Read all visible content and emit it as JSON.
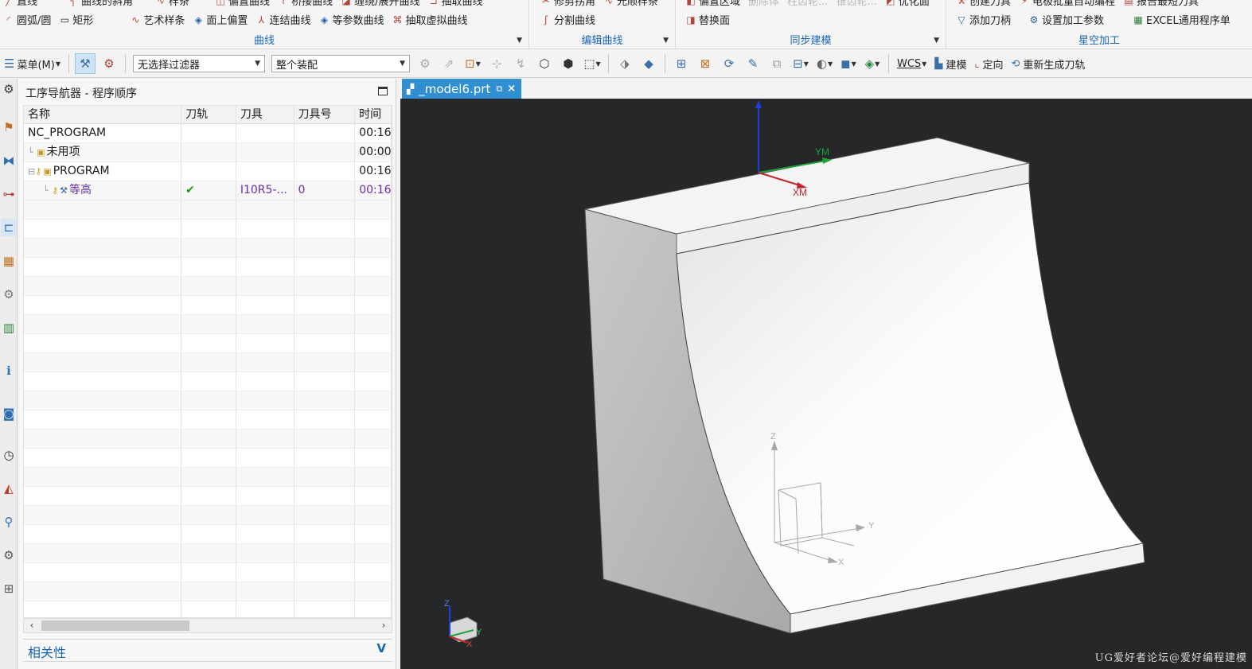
{
  "ribbon": {
    "curve_group": {
      "title": "曲线",
      "row1": [
        "直线",
        "曲线的斜角",
        "样条",
        "偏置曲线",
        "桥接曲线",
        "缠绕/展开曲线",
        "抽取曲线"
      ],
      "row2": [
        "圆弧/圆",
        "矩形",
        "艺术样条",
        "面上偏置",
        "连结曲线",
        "等参数曲线",
        "抽取虚拟曲线"
      ]
    },
    "edit_curve_group": {
      "title": "编辑曲线",
      "row1": [
        "修剪拐角",
        "光顺样条"
      ],
      "row2": [
        "分割曲线"
      ]
    },
    "sync_group": {
      "title": "同步建模",
      "row1": [
        "偏置区域",
        "删除体",
        "柱齿轮...",
        "锥齿轮...",
        "优化面"
      ],
      "row2": [
        "替换面"
      ]
    },
    "xingkong_group": {
      "title": "星空加工",
      "row1": [
        "创建刀具",
        "电极批量自动编程",
        "报告最短刀具"
      ],
      "row2": [
        "添加刀柄",
        "设置加工参数",
        "EXCEL通用程序单"
      ]
    }
  },
  "toolbar": {
    "menu_label": "菜单(M)",
    "filter_value": "无选择过滤器",
    "assembly_value": "整个装配",
    "wcs_label": "WCS",
    "model_label": "建模",
    "orient_label": "定向",
    "regen_label": "重新生成刀轨"
  },
  "navigator": {
    "title": "工序导航器 - 程序顺序",
    "columns": [
      "名称",
      "刀轨",
      "刀具",
      "刀具号",
      "时间"
    ],
    "rows": [
      {
        "name": "NC_PROGRAM",
        "path": "",
        "tool": "",
        "tool_no": "",
        "time": "00:16"
      },
      {
        "name": "未用项",
        "path": "",
        "tool": "",
        "tool_no": "",
        "time": "00:00"
      },
      {
        "name": "PROGRAM",
        "path": "",
        "tool": "",
        "tool_no": "",
        "time": "00:16"
      },
      {
        "name": "等高",
        "path": "✔",
        "tool": "I10R5-...",
        "tool_no": "0",
        "time": "00:16"
      }
    ],
    "related_label": "相关性"
  },
  "graphics": {
    "tab_label": "_model6.prt",
    "axis_ym": "YM",
    "axis_xm": "XM",
    "wcs_z": "Z",
    "wcs_y": "Y",
    "wcs_x": "X",
    "triad_z": "Z",
    "triad_y": "Y",
    "triad_x": "X",
    "watermark": "UG爱好者论坛@爱好编程建模"
  }
}
